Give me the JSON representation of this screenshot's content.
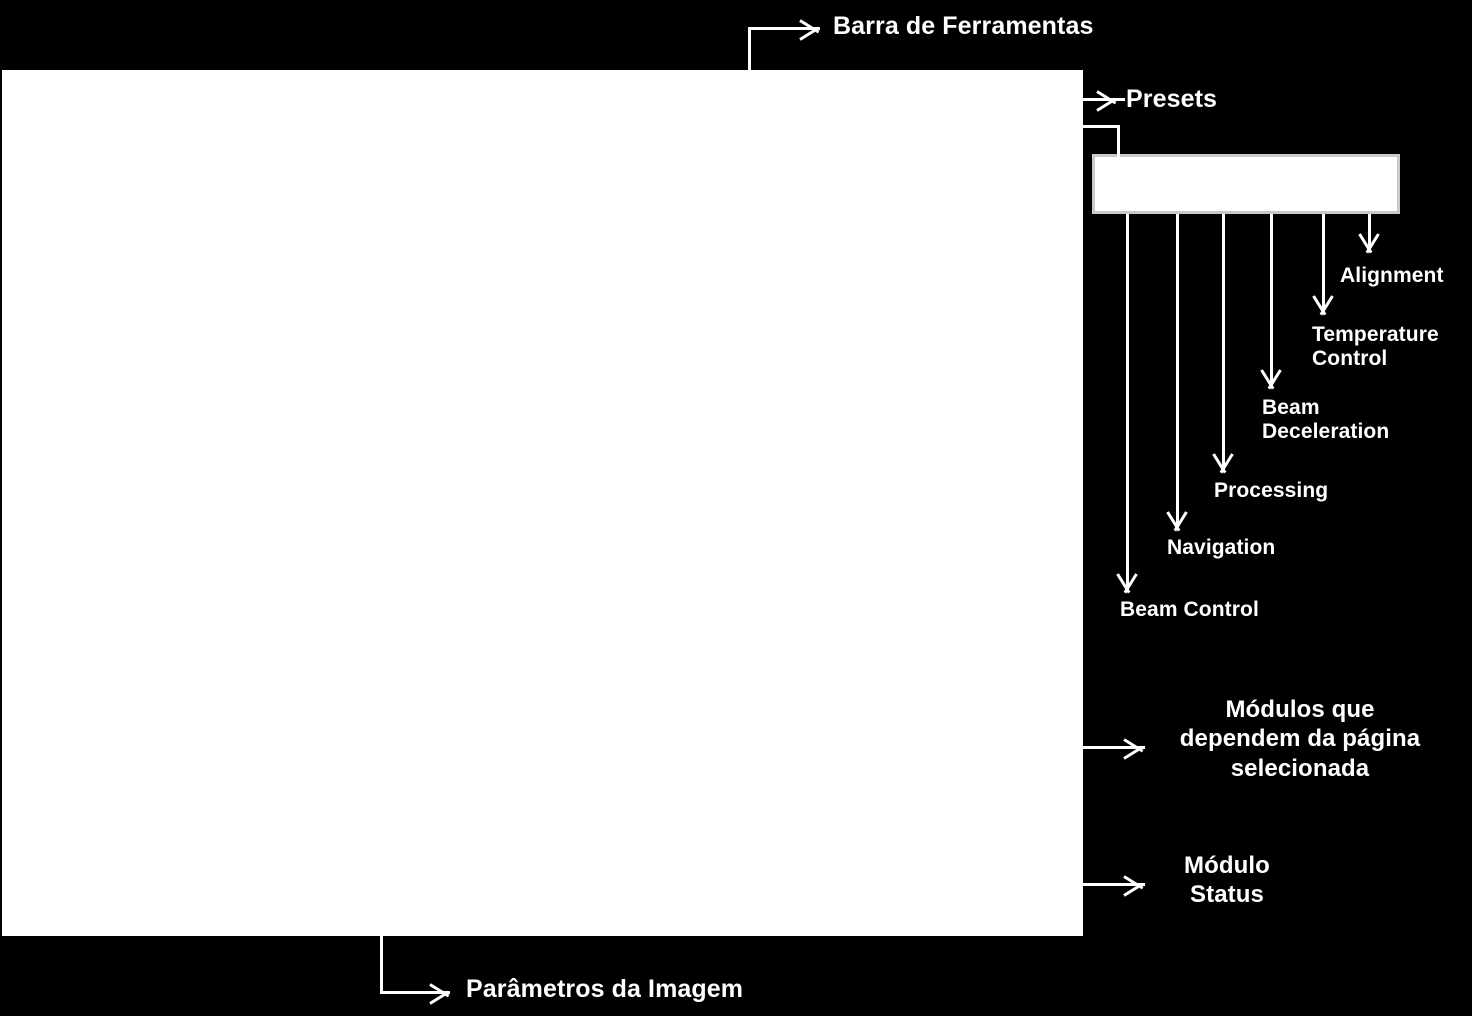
{
  "diagram": {
    "title": "Anotacoes da interface do microscopio",
    "background_color": "#000000",
    "label_color": "#ffffff",
    "panel_color": "#ffffff",
    "box_border_color": "#c9c9c9"
  },
  "panels": {
    "main_viewport": "",
    "presets_strip": ""
  },
  "callouts": {
    "toolbar": "Barra de Ferramentas",
    "presets": "Presets",
    "image_parameters": "Parâmetros da Imagem",
    "page_dependent_modules": "Módulos que\ndependem da página\nselecionada",
    "status_module": "Módulo\nStatus"
  },
  "preset_modules": [
    {
      "label": "Beam Control"
    },
    {
      "label": "Navigation"
    },
    {
      "label": "Processing"
    },
    {
      "label": "Beam\nDeceleration"
    },
    {
      "label": "Temperature\nControl"
    },
    {
      "label": "Alignment"
    }
  ]
}
